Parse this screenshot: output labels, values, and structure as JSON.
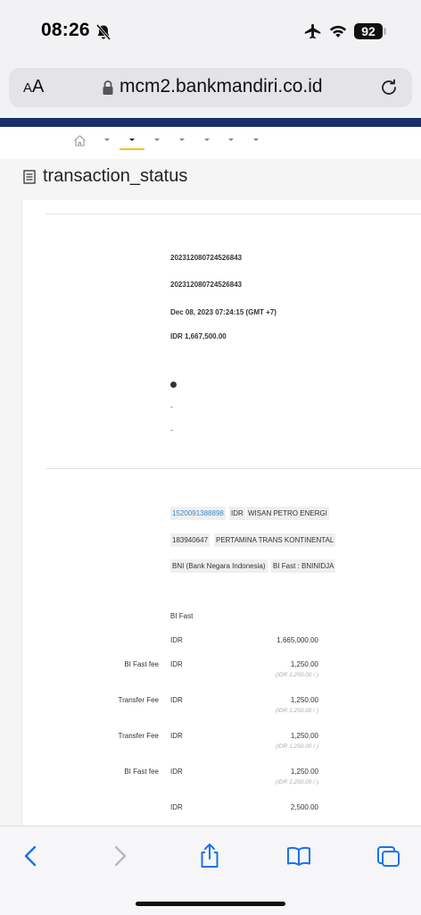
{
  "status_bar": {
    "time": "08:26",
    "battery": "92"
  },
  "browser": {
    "text_size_label_small": "A",
    "text_size_label_large": "A",
    "url": "mcm2.bankmandiri.co.id"
  },
  "page": {
    "title": "transaction_status"
  },
  "summary": {
    "ref_1": "202312080724526843",
    "ref_2": "202312080724526843",
    "datetime": "Dec 08, 2023 07:24:15 (GMT +7)",
    "amount": "IDR 1,667,500.00",
    "dash_1": "-",
    "dash_2": "-"
  },
  "accounts": {
    "source_account": "1520091388898",
    "source_currency": "IDR",
    "source_name": "WISAN PETRO ENERGI",
    "beneficiary_account": "183940647",
    "beneficiary_name": "PERTAMINA TRANS KONTINENTAL",
    "bank_name": "BNI (Bank Negara Indonesia)",
    "bank_code": "BI Fast : BNINIDJA"
  },
  "transfer": {
    "method": "BI Fast",
    "principal_currency": "IDR",
    "principal_amount": "1,665,000.00",
    "fees": [
      {
        "label": "BI Fast fee",
        "currency": "IDR",
        "amount": "1,250.00",
        "equiv": "(IDR 1,250.00 / )"
      },
      {
        "label": "Transfer Fee",
        "currency": "IDR",
        "amount": "1,250.00",
        "equiv": "(IDR 1,250.00 / )"
      },
      {
        "label": "Transfer Fee",
        "currency": "IDR",
        "amount": "1,250.00",
        "equiv": "(IDR 1,250.00 / )"
      },
      {
        "label": "BI Fast fee",
        "currency": "IDR",
        "amount": "1,250.00",
        "equiv": "(IDR 1,250.00 / )"
      }
    ],
    "total_currency": "IDR",
    "total_amount": "2,500.00"
  },
  "icons": {
    "bell": "bell-slash-icon",
    "airplane": "airplane-icon",
    "wifi": "wifi-icon",
    "lock": "lock-icon",
    "reload": "reload-icon",
    "home": "home-icon",
    "list": "list-icon",
    "back": "back-arrow-icon",
    "forward": "forward-arrow-icon",
    "share": "share-icon",
    "bookmarks": "book-icon",
    "tabs": "tabs-icon"
  },
  "colors": {
    "brand_navy": "#1b3068",
    "tab_underline": "#f2c21b",
    "link": "#3a87c8",
    "ios_blue": "#1a73e8"
  }
}
